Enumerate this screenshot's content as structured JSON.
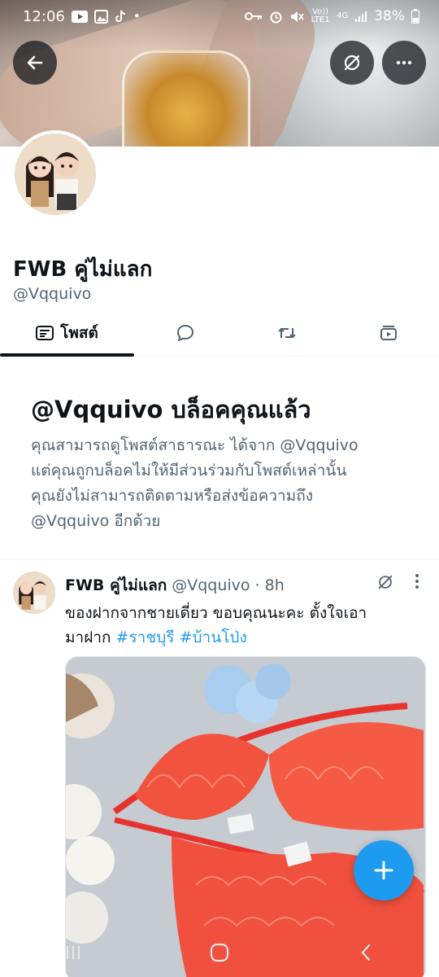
{
  "status_bar": {
    "time": "12:06",
    "network_label": "Vo)) LTE1",
    "network_type": "4G",
    "battery": "38%"
  },
  "profile": {
    "name": "FWB คู่ไม่แลก",
    "handle": "@Vqquivo"
  },
  "tabs": [
    {
      "label": "โพสต์",
      "icon": "posts-icon",
      "active": true
    },
    {
      "label": "",
      "icon": "reply-icon",
      "active": false
    },
    {
      "label": "",
      "icon": "repost-icon",
      "active": false
    },
    {
      "label": "",
      "icon": "media-icon",
      "active": false
    }
  ],
  "blocked": {
    "title": "@Vqquivo บล็อคคุณแล้ว",
    "lines": [
      "คุณสามารถดูโพสต์สาธารณะ ได้จาก @Vqquivo",
      "แต่คุณถูกบล็อคไม่ให้มีส่วนร่วมกับโพสต์เหล่านั้น",
      "คุณยังไม่สามารถติดตามหรือส่งข้อความถึง",
      "@Vqquivo อีกด้วย"
    ]
  },
  "post": {
    "name": "FWB คู่ไม่แลก",
    "handle": "@Vqquivo",
    "time": "· 8h",
    "line1": "ของฝากจากชายเดี่ยว ขอบคุณนะคะ ตั้งใจเอา",
    "line2_text": "มาฝาก ",
    "hashtag1": "#ราชบุรี",
    "hashtag2": "#บ้านโป่ง"
  },
  "colors": {
    "accent": "#1d9bf0",
    "text_primary": "#0f1419",
    "text_secondary": "#536471"
  }
}
